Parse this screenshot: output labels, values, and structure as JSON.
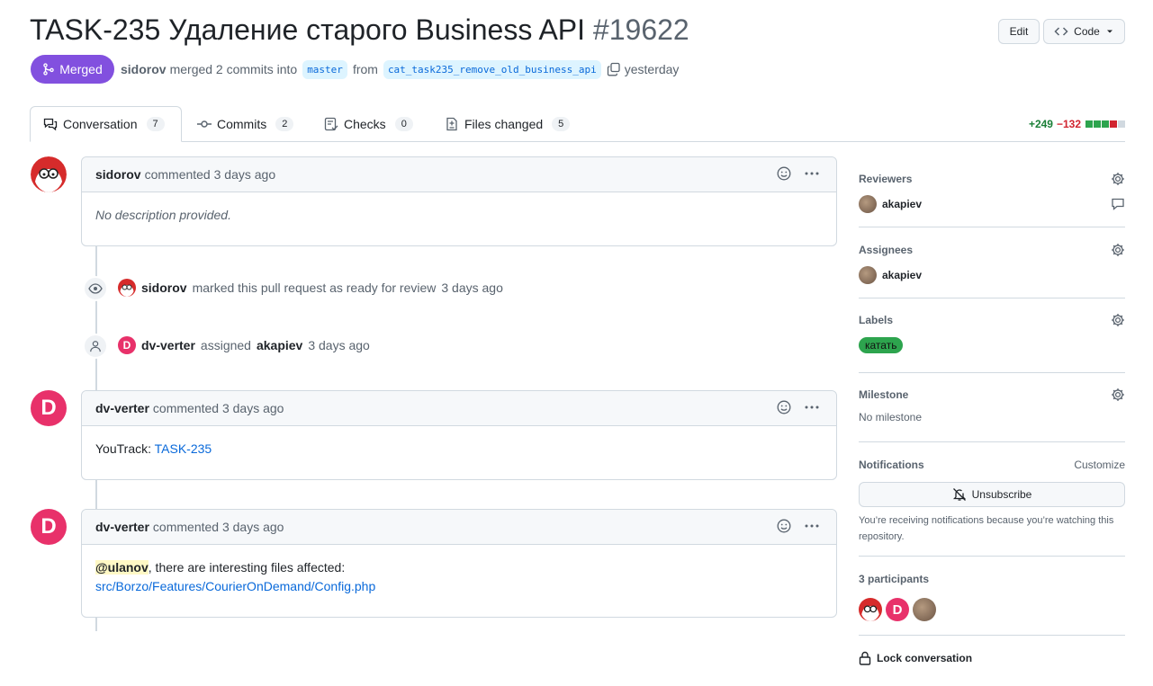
{
  "header": {
    "title": "TASK-235 Удаление старого Business API",
    "number": "#19622",
    "edit_label": "Edit",
    "code_label": "Code",
    "state_label": "Merged",
    "author": "sidorov",
    "merge_text": "merged 2 commits into",
    "base_branch": "master",
    "from_text": "from",
    "head_branch": "cat_task235_remove_old_business_api",
    "time": "yesterday"
  },
  "tabs": [
    {
      "label": "Conversation",
      "count": "7"
    },
    {
      "label": "Commits",
      "count": "2"
    },
    {
      "label": "Checks",
      "count": "0"
    },
    {
      "label": "Files changed",
      "count": "5"
    }
  ],
  "diffstat": {
    "additions": "+249",
    "deletions": "−132",
    "blocks": [
      "green",
      "green",
      "green",
      "red",
      "gray"
    ]
  },
  "timeline": {
    "comment1": {
      "author": "sidorov",
      "action": "commented",
      "time": "3 days ago",
      "body": "No description provided."
    },
    "event1": {
      "author": "sidorov",
      "text": "marked this pull request as ready for review",
      "time": "3 days ago"
    },
    "event2": {
      "author": "dv-verter",
      "text": "assigned",
      "target": "akapiev",
      "time": "3 days ago"
    },
    "comment2": {
      "author": "dv-verter",
      "action": "commented",
      "time": "3 days ago",
      "body_prefix": "YouTrack:",
      "link": "TASK-235"
    },
    "comment3": {
      "author": "dv-verter",
      "action": "commented",
      "time": "3 days ago",
      "mention": "@ulanov",
      "body_text": ", there are interesting files affected:",
      "link": "src/Borzo/Features/CourierOnDemand/Config.php"
    },
    "avatar_letter": "D"
  },
  "sidebar": {
    "reviewers": {
      "title": "Reviewers",
      "user": "akapiev"
    },
    "assignees": {
      "title": "Assignees",
      "user": "akapiev"
    },
    "labels": {
      "title": "Labels",
      "label": "катать",
      "label_color": "#2da44e"
    },
    "milestone": {
      "title": "Milestone",
      "value": "No milestone"
    },
    "notifications": {
      "title": "Notifications",
      "customize": "Customize",
      "button": "Unsubscribe",
      "note": "You’re receiving notifications because you’re watching this repository."
    },
    "participants": {
      "title": "3 participants"
    },
    "lock": "Lock conversation"
  },
  "colors": {
    "merged": "#8250df",
    "link": "#0969da",
    "avatar_pink": "#e8316a"
  }
}
